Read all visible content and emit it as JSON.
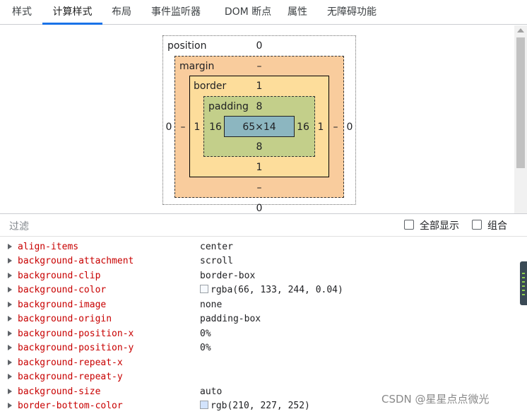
{
  "tabs": [
    "样式",
    "计算样式",
    "布局",
    "事件监听器",
    "DOM 断点",
    "属性",
    "无障碍功能"
  ],
  "active_tab": "计算样式",
  "box_model": {
    "position": {
      "label": "position",
      "top": "0",
      "bottom": "0",
      "left": "0",
      "right": "0"
    },
    "margin": {
      "label": "margin",
      "top": "–",
      "bottom": "–",
      "left": "–",
      "right": "–"
    },
    "border": {
      "label": "border",
      "top": "1",
      "bottom": "1",
      "left": "1",
      "right": "1"
    },
    "padding": {
      "label": "padding",
      "top": "8",
      "bottom": "8",
      "left": "16",
      "right": "16"
    },
    "content": "65×14"
  },
  "filter": {
    "placeholder": "过滤",
    "show_all_label": "全部显示",
    "group_label": "组合"
  },
  "properties": [
    {
      "name": "align-items",
      "value": "center"
    },
    {
      "name": "background-attachment",
      "value": "scroll"
    },
    {
      "name": "background-clip",
      "value": "border-box"
    },
    {
      "name": "background-color",
      "value": "rgba(66, 133, 244, 0.04)",
      "swatch": "#f7faff"
    },
    {
      "name": "background-image",
      "value": "none"
    },
    {
      "name": "background-origin",
      "value": "padding-box"
    },
    {
      "name": "background-position-x",
      "value": "0%"
    },
    {
      "name": "background-position-y",
      "value": "0%"
    },
    {
      "name": "background-repeat-x",
      "value": ""
    },
    {
      "name": "background-repeat-y",
      "value": ""
    },
    {
      "name": "background-size",
      "value": "auto"
    },
    {
      "name": "border-bottom-color",
      "value": "rgb(210, 227, 252)",
      "swatch": "#d2e3fc"
    }
  ],
  "watermark": "CSDN @星星点点微光"
}
